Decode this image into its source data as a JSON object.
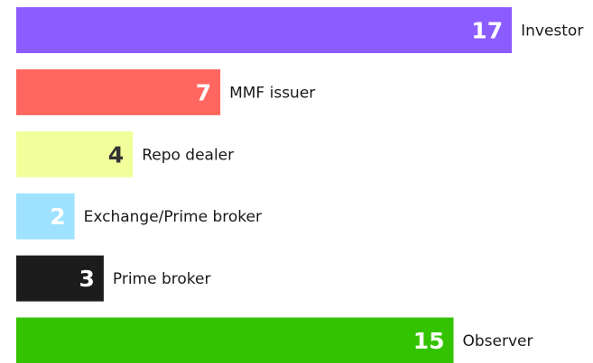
{
  "chart_data": {
    "type": "bar",
    "orientation": "horizontal",
    "title": "",
    "xlabel": "",
    "ylabel": "",
    "xlim": [
      0,
      17
    ],
    "grid": false,
    "legend": "none",
    "categories": [
      "Investor",
      "MMF issuer",
      "Repo dealer",
      "Exchange/Prime broker",
      "Prime broker",
      "Observer"
    ],
    "values": [
      17,
      7,
      4,
      2,
      3,
      15
    ],
    "colors": [
      "#8b5cff",
      "#ff6660",
      "#f1ff9b",
      "#9ee2ff",
      "#1c1c1c",
      "#33c300"
    ],
    "value_label_colors": [
      "#ffffff",
      "#ffffff",
      "#333333",
      "#ffffff",
      "#ffffff",
      "#ffffff"
    ]
  }
}
